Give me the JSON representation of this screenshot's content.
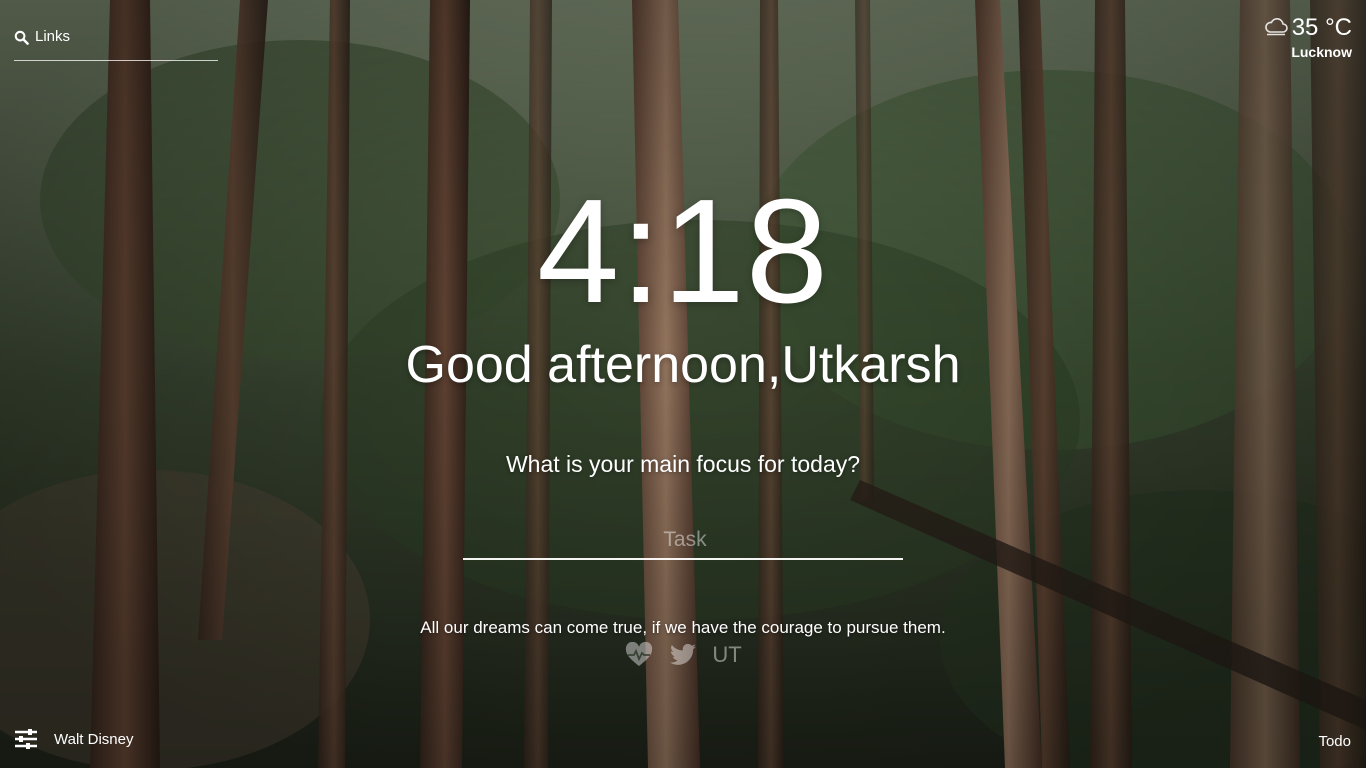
{
  "top_left": {
    "links_label": "Links",
    "icon": "search-icon"
  },
  "weather": {
    "icon": "cloud-icon",
    "temperature": "35 °C",
    "city": "Lucknow"
  },
  "clock": {
    "time": "4:18"
  },
  "greeting": {
    "text": "Good afternoon,Utkarsh"
  },
  "focus": {
    "question": "What is your main focus for today?",
    "input_placeholder": "Task",
    "input_value": ""
  },
  "quote": {
    "text": "All our dreams can come true, if we have the courage to pursue them.",
    "author": "Walt Disney",
    "actions": {
      "like_icon": "heart-pulse-icon",
      "share_icon": "twitter-icon",
      "user_initials": "UT"
    }
  },
  "bottom": {
    "settings_icon": "sliders-icon",
    "todo_label": "Todo"
  },
  "colors": {
    "text": "#ffffff",
    "muted": "rgba(255,255,255,0.45)"
  }
}
